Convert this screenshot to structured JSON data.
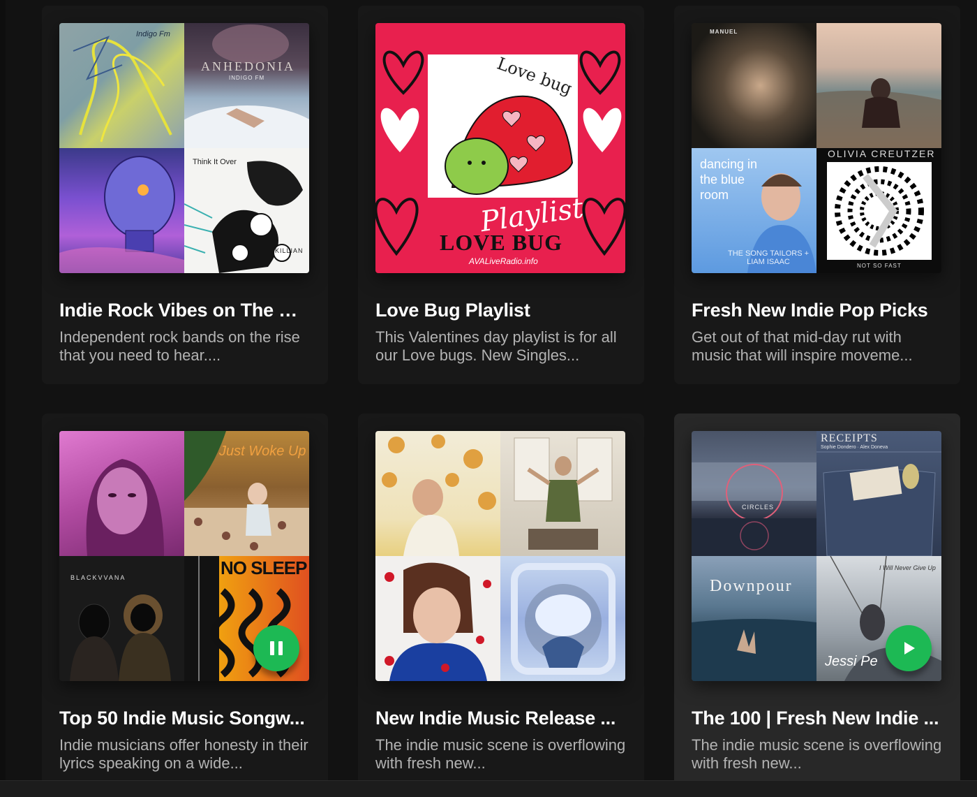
{
  "playlists": [
    {
      "title": "Indie Rock Vibes on The Rise",
      "description": "Independent rock bands on the rise that you need to hear....",
      "cover_art_text": [
        "Indigo Fm",
        "ANHEDONIA",
        "INDIGO FM",
        "Think It Over",
        "KILLIAN"
      ]
    },
    {
      "title": "Love Bug Playlist",
      "description": "This Valentines day playlist is for all our Love bugs. New Singles...",
      "cover_art_text": [
        "Love bug",
        "Playlist",
        "LOVE BUG",
        "AVALiveRadio.info"
      ]
    },
    {
      "title": "Fresh New Indie Pop Picks",
      "description": "Get out of that mid-day rut with music that will inspire moveme...",
      "cover_art_text": [
        "MANUEL",
        "dancing in the blue room",
        "THE SONG TAILORS + LIAM ISAAC",
        "OLIVIA CREUTZER",
        "NOT SO FAST"
      ]
    },
    {
      "title": "Top 50 Indie Music Songw...",
      "description": "Indie musicians offer honesty in their lyrics speaking on a wide...",
      "cover_art_text": [
        "Just Woke Up",
        "BLACKVVANA",
        "NO SLEEP"
      ],
      "play_state": "playing"
    },
    {
      "title": "New Indie Music Release ...",
      "description": "The indie music scene is overflowing with fresh new...",
      "cover_art_text": []
    },
    {
      "title": "The 100 | Fresh New Indie ...",
      "description": "The indie music scene is overflowing with fresh new...",
      "cover_art_text": [
        "CIRCLES",
        "RECEIPTS",
        "Sophie Dondero · Alex Doneva",
        "Downpour",
        "I Will Never Give Up",
        "Jessi Pe"
      ],
      "play_state": "paused",
      "hovered": true
    }
  ],
  "colors": {
    "background": "#121212",
    "card": "#181818",
    "card_hover": "#282828",
    "accent_green": "#1db954",
    "secondary_text": "#b3b3b3"
  }
}
